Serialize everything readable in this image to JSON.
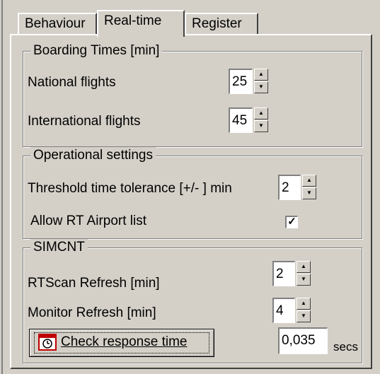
{
  "tabs": [
    {
      "label": "Behaviour"
    },
    {
      "label": "Real-time"
    },
    {
      "label": "Register"
    }
  ],
  "boarding": {
    "legend": "Boarding Times  [min]",
    "national_label": "National flights",
    "national_value": "25",
    "international_label": "International flights",
    "international_value": "45"
  },
  "operational": {
    "legend": "Operational settings",
    "threshold_label": "Threshold time tolerance [+/- ] min",
    "threshold_value": "2",
    "allow_label": "Allow RT Airport list",
    "allow_checked": true
  },
  "simcnt": {
    "legend": "SIMCNT",
    "rtscan_label": "RTScan Refresh [min]",
    "rtscan_value": "2",
    "monitor_label": "Monitor Refresh [min]",
    "monitor_value": "4",
    "check_button_label": "Check response time",
    "response_value": "0,035",
    "secs_label": "secs"
  },
  "colors": {
    "face": "#d4d0c8",
    "clock_red": "#c00000"
  }
}
